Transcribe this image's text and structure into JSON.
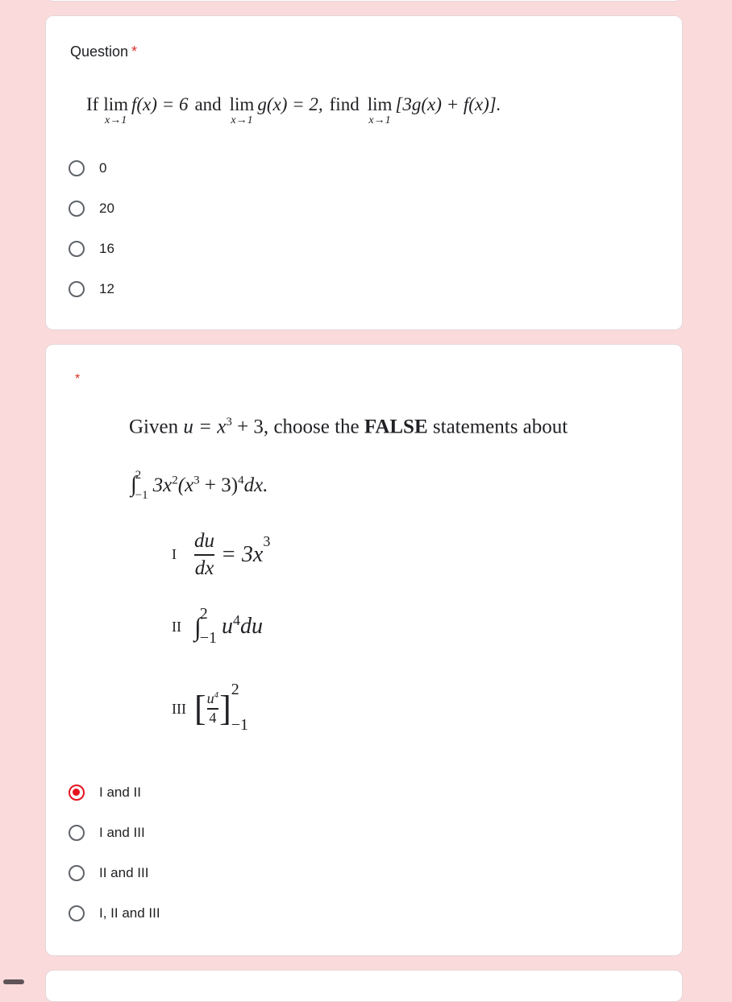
{
  "question1": {
    "title": "Question",
    "required_marker": "*",
    "text_if": "If",
    "lim_word": "lim",
    "lim_sub": "x→1",
    "part1_expr": "f(x) = 6",
    "text_and": "and",
    "part2_expr": "g(x) = 2,",
    "text_find": "find",
    "part3_expr": "[3g(x) + f(x)].",
    "options": [
      {
        "label": "0",
        "selected": false
      },
      {
        "label": "20",
        "selected": false
      },
      {
        "label": "16",
        "selected": false
      },
      {
        "label": "12",
        "selected": false
      }
    ]
  },
  "question2": {
    "required_marker": "*",
    "text_given": "Given",
    "u_def": "u = x",
    "u_def_exp": "3",
    "u_def_rest": " + 3,",
    "text_choose": "choose the",
    "text_false": "FALSE",
    "text_statements": "statements about",
    "integral_sign": "∫",
    "integral_upper": "2",
    "integral_lower": "−1",
    "integrand_a": "3x",
    "integrand_a_exp": "2",
    "integrand_b": "(x",
    "integrand_b_exp": "3",
    "integrand_c": " + 3)",
    "integrand_c_exp": "4",
    "integrand_d": "dx.",
    "statements": [
      {
        "numeral": "I",
        "frac_num": "du",
        "frac_den": "dx",
        "rhs": "= 3x",
        "rhs_exp": "3"
      },
      {
        "numeral": "II",
        "integral_sign": "∫",
        "upper": "2",
        "lower": "−1",
        "body": "u",
        "body_exp": "4",
        "body_rest": "du"
      },
      {
        "numeral": "III",
        "frac_num": "u",
        "frac_num_exp": "4",
        "frac_den": "4",
        "upper": "2",
        "lower": "−1",
        "left_bracket": "[",
        "right_bracket": "]"
      }
    ],
    "options": [
      {
        "label": "I and II",
        "selected": true
      },
      {
        "label": "I and III",
        "selected": false
      },
      {
        "label": "II and III",
        "selected": false
      },
      {
        "label": "I, II and III",
        "selected": false
      }
    ]
  },
  "colors": {
    "background": "#fadadb",
    "card": "#ffffff",
    "required": "#d93025",
    "radio_selected": "#e5131e",
    "radio_unselected": "#5f6368"
  }
}
